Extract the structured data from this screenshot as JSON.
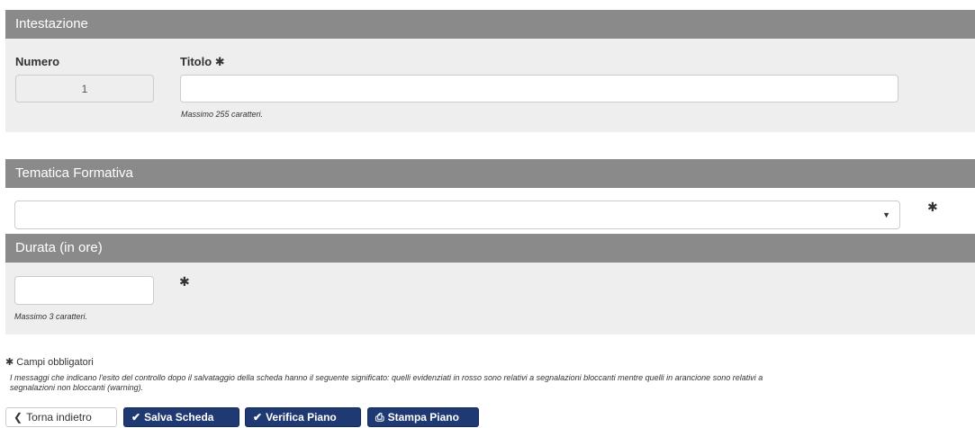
{
  "intestazione": {
    "title": "Intestazione",
    "numero_label": "Numero",
    "numero_value": "1",
    "titolo_label": "Titolo",
    "titolo_value": "",
    "titolo_hint": "Massimo 255 caratteri."
  },
  "tematica": {
    "title": "Tematica Formativa",
    "selected": ""
  },
  "durata": {
    "title": "Durata (in ore)",
    "value": "",
    "hint": "Massimo 3 caratteri."
  },
  "footer": {
    "required_note": "Campi obbligatori",
    "info_line_1": "I messaggi che indicano l'esito del controllo dopo il salvataggio della scheda hanno il seguente significato: quelli evidenziati in rosso sono relativi a segnalazioni bloccanti mentre quelli in arancione sono relativi a",
    "info_line_2": "segnalazioni non bloccanti (warning)."
  },
  "buttons": {
    "back": "Torna indietro",
    "save": "Salva Scheda",
    "verify": "Verifica Piano",
    "print": "Stampa Piano"
  },
  "icons": {
    "required": "asterisk-icon",
    "back": "chevron-left-icon",
    "save": "check-icon",
    "verify": "check-icon",
    "print": "printer-icon",
    "dropdown": "caret-down-icon"
  },
  "colors": {
    "header_bg": "#8a8a8a",
    "body_bg": "#eeeeee",
    "primary_button": "#1f3a73"
  }
}
